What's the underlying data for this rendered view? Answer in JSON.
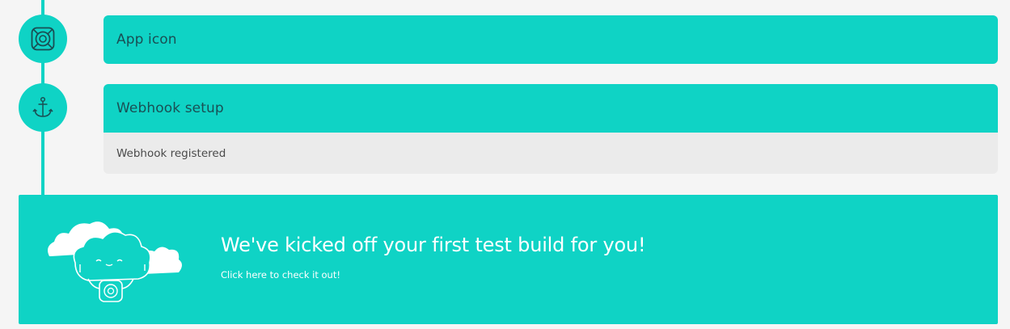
{
  "steps": [
    {
      "title": "App icon",
      "icon": "app-icon-icon"
    },
    {
      "title": "Webhook setup",
      "icon": "anchor-icon",
      "detail": "Webhook registered"
    }
  ],
  "banner": {
    "title": "We've kicked off your first test build for you!",
    "link": "Click here to check it out!",
    "illustration": "cloud-mascot-icon"
  },
  "colors": {
    "accent": "#0fd3c5",
    "header_text": "#1a4f54",
    "detail_bg": "#ebebeb",
    "page_bg": "#f5f5f5"
  }
}
